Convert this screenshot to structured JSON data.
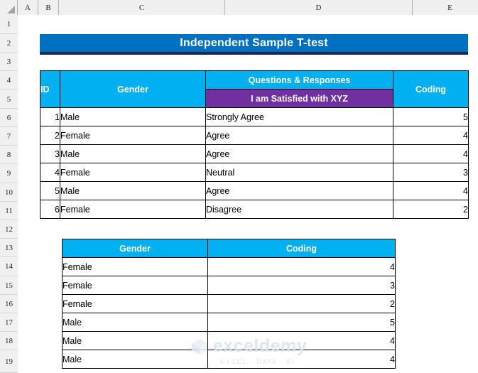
{
  "app": {
    "type": "spreadsheet",
    "select_all_icon": "select-all-triangle-icon"
  },
  "grid": {
    "column_headers": [
      "A",
      "B",
      "C",
      "D",
      "E"
    ],
    "row_headers": [
      "1",
      "2",
      "3",
      "4",
      "5",
      "6",
      "7",
      "8",
      "9",
      "10",
      "11",
      "12",
      "13",
      "14",
      "15",
      "16",
      "17",
      "18",
      "19"
    ]
  },
  "title_banner": {
    "text": "Independent Sample T-test",
    "bg_color": "#0070C0",
    "underline_color": "#13275C",
    "text_color": "#FFFFFF"
  },
  "main_table": {
    "headers": {
      "id": "ID",
      "gender": "Gender",
      "questions_group": "Questions & Responses",
      "question_sub": "I am Satisfied with XYZ",
      "coding": "Coding"
    },
    "header_bg": "#00B0F0",
    "subheader_bg": "#7030A0",
    "rows": [
      {
        "id": "1",
        "gender": "Male",
        "response": "Strongly Agree",
        "coding": "5"
      },
      {
        "id": "2",
        "gender": "Female",
        "response": "Agree",
        "coding": "4"
      },
      {
        "id": "3",
        "gender": "Male",
        "response": "Agree",
        "coding": "4"
      },
      {
        "id": "4",
        "gender": "Female",
        "response": "Neutral",
        "coding": "3"
      },
      {
        "id": "5",
        "gender": "Male",
        "response": "Agree",
        "coding": "4"
      },
      {
        "id": "6",
        "gender": "Female",
        "response": "Disagree",
        "coding": "2"
      }
    ]
  },
  "sub_table": {
    "headers": {
      "gender": "Gender",
      "coding": "Coding"
    },
    "header_bg": "#00B0F0",
    "rows": [
      {
        "gender": "Female",
        "coding": "4"
      },
      {
        "gender": "Female",
        "coding": "3"
      },
      {
        "gender": "Female",
        "coding": "2"
      },
      {
        "gender": "Male",
        "coding": "5"
      },
      {
        "gender": "Male",
        "coding": "4"
      },
      {
        "gender": "Male",
        "coding": "4"
      }
    ]
  },
  "watermark": {
    "brand": "exceldemy",
    "tagline": "EXCEL · DATA · BI",
    "logo_icon": "exceldemy-cube-logo-icon"
  }
}
